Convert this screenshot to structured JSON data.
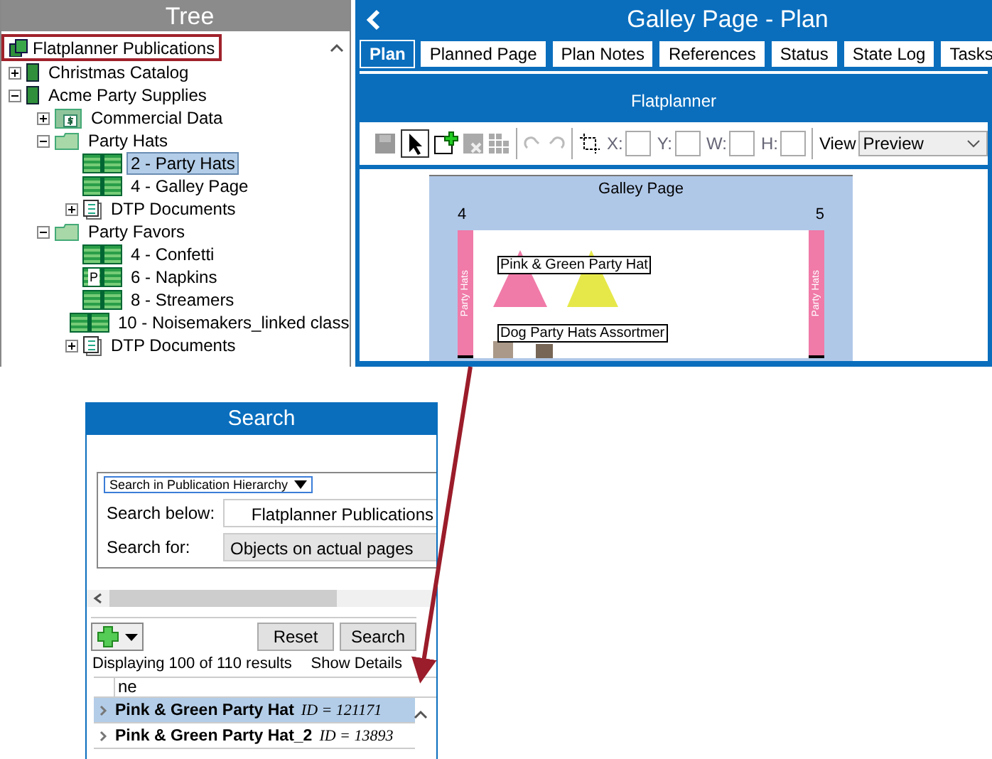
{
  "tree": {
    "title": "Tree",
    "root": {
      "label": "Flatplanner Publications",
      "highlighted": true
    },
    "items": [
      {
        "label": "Christmas Catalog",
        "kind": "publication",
        "expanded": false,
        "selected": false
      },
      {
        "label": "Acme Party Supplies",
        "kind": "publication",
        "expanded": true,
        "selected": false,
        "children": [
          {
            "label": "Commercial Data",
            "kind": "commercial",
            "expanded": false,
            "selected": false
          },
          {
            "label": "Party Hats",
            "kind": "folder",
            "expanded": true,
            "selected": false,
            "children": [
              {
                "label": "2 - Party Hats",
                "kind": "page",
                "selected": true
              },
              {
                "label": "4 - Galley Page",
                "kind": "page",
                "selected": false
              },
              {
                "label": "DTP Documents",
                "kind": "dtp",
                "expanded": false,
                "selected": false
              }
            ]
          },
          {
            "label": "Party Favors",
            "kind": "folder",
            "expanded": true,
            "selected": false,
            "children": [
              {
                "label": "4 - Confetti",
                "kind": "page",
                "selected": false
              },
              {
                "label": "6 - Napkins",
                "kind": "page",
                "badge": "P",
                "selected": false
              },
              {
                "label": "8 - Streamers",
                "kind": "page",
                "selected": false
              },
              {
                "label": "10 - Noisemakers_linked class",
                "kind": "page",
                "selected": false
              },
              {
                "label": "DTP Documents",
                "kind": "dtp",
                "expanded": false,
                "selected": false
              }
            ]
          }
        ]
      }
    ]
  },
  "plan": {
    "title": "Galley Page - Plan",
    "tabs": [
      {
        "label": "Plan",
        "selected": true
      },
      {
        "label": "Planned Page",
        "selected": false
      },
      {
        "label": "Plan Notes",
        "selected": false
      },
      {
        "label": "References",
        "selected": false
      },
      {
        "label": "Status",
        "selected": false
      },
      {
        "label": "State Log",
        "selected": false
      },
      {
        "label": "Tasks",
        "selected": false
      }
    ],
    "section": "Flatplanner",
    "coords": [
      {
        "label": "X:"
      },
      {
        "label": "Y:"
      },
      {
        "label": "W:"
      },
      {
        "label": "H:"
      }
    ],
    "view_label": "View",
    "view_value": "Preview",
    "spread": {
      "title": "Galley Page",
      "left_page": "4",
      "right_page": "5",
      "section_tab": "Party Hats",
      "right_tab": "Party Hats",
      "objects": [
        {
          "label": "Pink & Green Party Hat"
        },
        {
          "label": "Dog Party Hats Assortmer"
        }
      ]
    }
  },
  "search": {
    "title": "Search",
    "scope": "Search in Publication Hierarchy",
    "below_label": "Search below:",
    "below_value": "Flatplanner Publications",
    "for_label": "Search for:",
    "for_value": "Objects on actual pages",
    "buttons": [
      "Reset",
      "Search"
    ],
    "count": "Displaying 100 of 110 results",
    "details": "Show Details",
    "column": "ne",
    "rows": [
      {
        "name": "Pink & Green Party Hat",
        "id": "ID = 121171",
        "selected": true
      },
      {
        "name": "Pink & Green Party Hat_2",
        "id": "ID = 13893",
        "selected": false
      }
    ]
  }
}
